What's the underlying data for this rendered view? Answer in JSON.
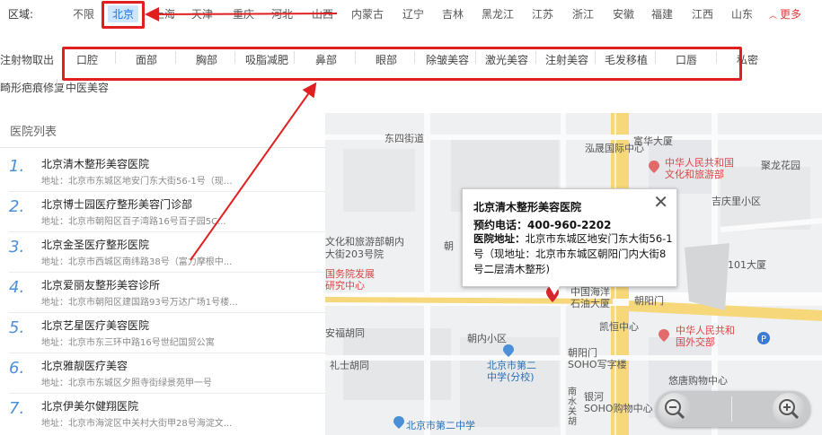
{
  "region": {
    "label": "区域:",
    "items": [
      "不限",
      "北京",
      "上海",
      "天津",
      "重庆",
      "河北",
      "山西",
      "内蒙古",
      "辽宁",
      "吉林",
      "黑龙江",
      "江苏",
      "浙江",
      "安徽",
      "福建",
      "江西",
      "山东"
    ],
    "active": "北京",
    "more": "更多"
  },
  "categories": {
    "row1": [
      "注射物取出",
      "口腔",
      "面部",
      "胸部",
      "吸脂减肥",
      "鼻部",
      "眼部",
      "除皱美容",
      "激光美容",
      "注射美容",
      "毛发移植",
      "口唇",
      "私密"
    ],
    "row2": [
      "畸形疤痕修复",
      "中医美容"
    ]
  },
  "hospital_list": {
    "title": "医院列表",
    "items": [
      {
        "num": "1.",
        "name": "北京清木整形美容医院",
        "addr": "地址：北京市东城区地安门东大街56-1号（现地..."
      },
      {
        "num": "2.",
        "name": "北京博士园医疗整形美容门诊部",
        "addr": "地址：北京市朝阳区百子湾路16号百子园5C..."
      },
      {
        "num": "3.",
        "name": "北京金圣医疗整形医院",
        "addr": "地址：北京市西城区南纬路38号（富力摩根中..."
      },
      {
        "num": "4.",
        "name": "北京爱丽友整形美容诊所",
        "addr": "地址：北京市朝阳区建国路93号万达广场1号楼..."
      },
      {
        "num": "5.",
        "name": "北京艺星医疗美容医院",
        "addr": "地址：北京市东三环中路16号世纪国贸公寓"
      },
      {
        "num": "6.",
        "name": "北京雅靓医疗美容",
        "addr": "地址：北京市东城区夕照寺街绿景苑甲一号"
      },
      {
        "num": "7.",
        "name": "北京伊美尔健翔医院",
        "addr": "地址：北京市海淀区中关村大街甲28号海淀文..."
      }
    ]
  },
  "map": {
    "labels": {
      "dongsi": "东四街道",
      "hongsheng": "泓晟国际中心",
      "fuhua": "富华大厦",
      "ministry_culture": "中华人民共和国\n文化和旅游部",
      "juxing": "聚龙花园",
      "jiqing": "吉庆里小区",
      "wenhua_left": "文化和旅游部朝内\n大街203号院",
      "chao": "朝",
      "guowuyuan": "国务院发展\n研究中心",
      "nanxiao": "朝内小区",
      "anfu": "安福胡同",
      "lishi": "礼士胡同",
      "haiyang": "中国海洋\n石油大厦",
      "chaoyangmen": "朝阳门",
      "kaixin": "凯恒中心",
      "waijiao": "中华人民共和\n国外交部",
      "soho": "朝阳门\nSOHO写字楼",
      "school": "北京市第二\n中学(分校)",
      "school2": "北京市第二中学",
      "yinhe": "银河\nSOHO购物中心",
      "youtang": "悠唐购物中心",
      "nanshui": "南\n水\n关\n胡",
      "building101": "101大厦"
    }
  },
  "popup": {
    "title": "北京清木整形美容医院",
    "phone_label": "预约电话：",
    "phone": "400-960-2202",
    "addr_label": "医院地址：",
    "addr": "北京市东城区地安门东大街56-1号（现地址：北京市东城区朝阳门内大街8号二层清木整形)",
    "close": "✕"
  },
  "colors": {
    "accent_red": "#e02020",
    "active_bg": "#cfe6ff",
    "num_blue": "#4a90d9"
  }
}
